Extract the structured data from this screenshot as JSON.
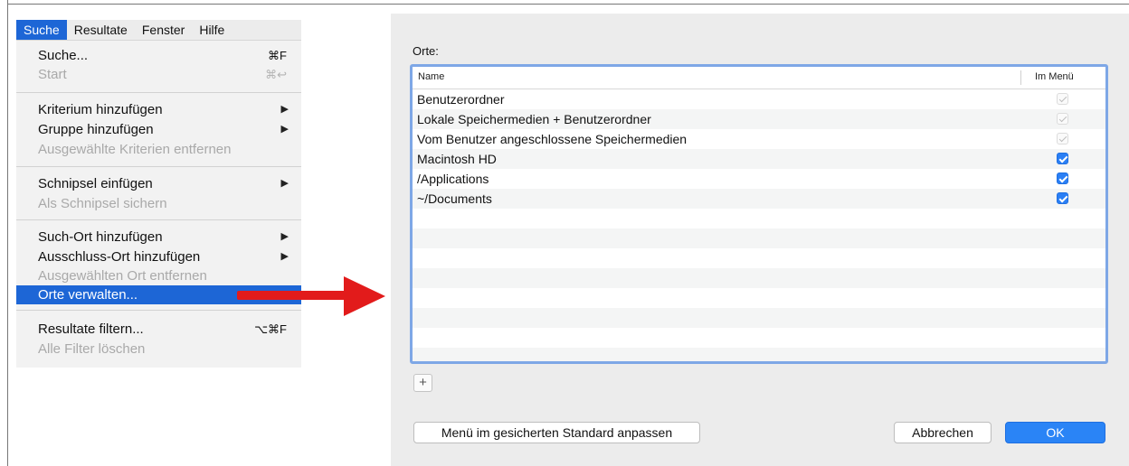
{
  "menubar": {
    "items": [
      "Suche",
      "Resultate",
      "Fenster",
      "Hilfe"
    ]
  },
  "menu": {
    "items": [
      {
        "label": "Suche...",
        "shortcut": "⌘F"
      },
      {
        "label": "Start",
        "shortcut": "⌘↩"
      },
      {
        "label": "Kriterium hinzufügen"
      },
      {
        "label": "Gruppe hinzufügen"
      },
      {
        "label": "Ausgewählte Kriterien entfernen"
      },
      {
        "label": "Schnipsel einfügen"
      },
      {
        "label": "Als Schnipsel sichern"
      },
      {
        "label": "Such-Ort hinzufügen"
      },
      {
        "label": "Ausschluss-Ort hinzufügen"
      },
      {
        "label": "Ausgewählten Ort entfernen"
      },
      {
        "label": "Orte verwalten..."
      },
      {
        "label": "Resultate filtern...",
        "shortcut": "⌥⌘F"
      },
      {
        "label": "Alle Filter löschen"
      }
    ],
    "submenu_icon": "triangle-right-icon"
  },
  "annotation": {
    "icon": "red-arrow-icon",
    "color": "#e21b1b"
  },
  "dialog": {
    "section_label": "Orte:",
    "columns": {
      "name": "Name",
      "in_menu": "Im Menü"
    },
    "rows": [
      {
        "name": "Benutzerordner",
        "checked": false
      },
      {
        "name": "Lokale Speichermedien + Benutzerordner",
        "checked": false
      },
      {
        "name": "Vom Benutzer angeschlossene Speichermedien",
        "checked": false
      },
      {
        "name": "Macintosh HD",
        "checked": true
      },
      {
        "name": "/Applications",
        "checked": true
      },
      {
        "name": "~/Documents",
        "checked": true
      }
    ],
    "add_button": "+",
    "reset_button": "Menü im gesicherten Standard anpassen",
    "cancel_button": "Abbrechen",
    "ok_button": "OK",
    "accent_color": "#2a84f6"
  }
}
